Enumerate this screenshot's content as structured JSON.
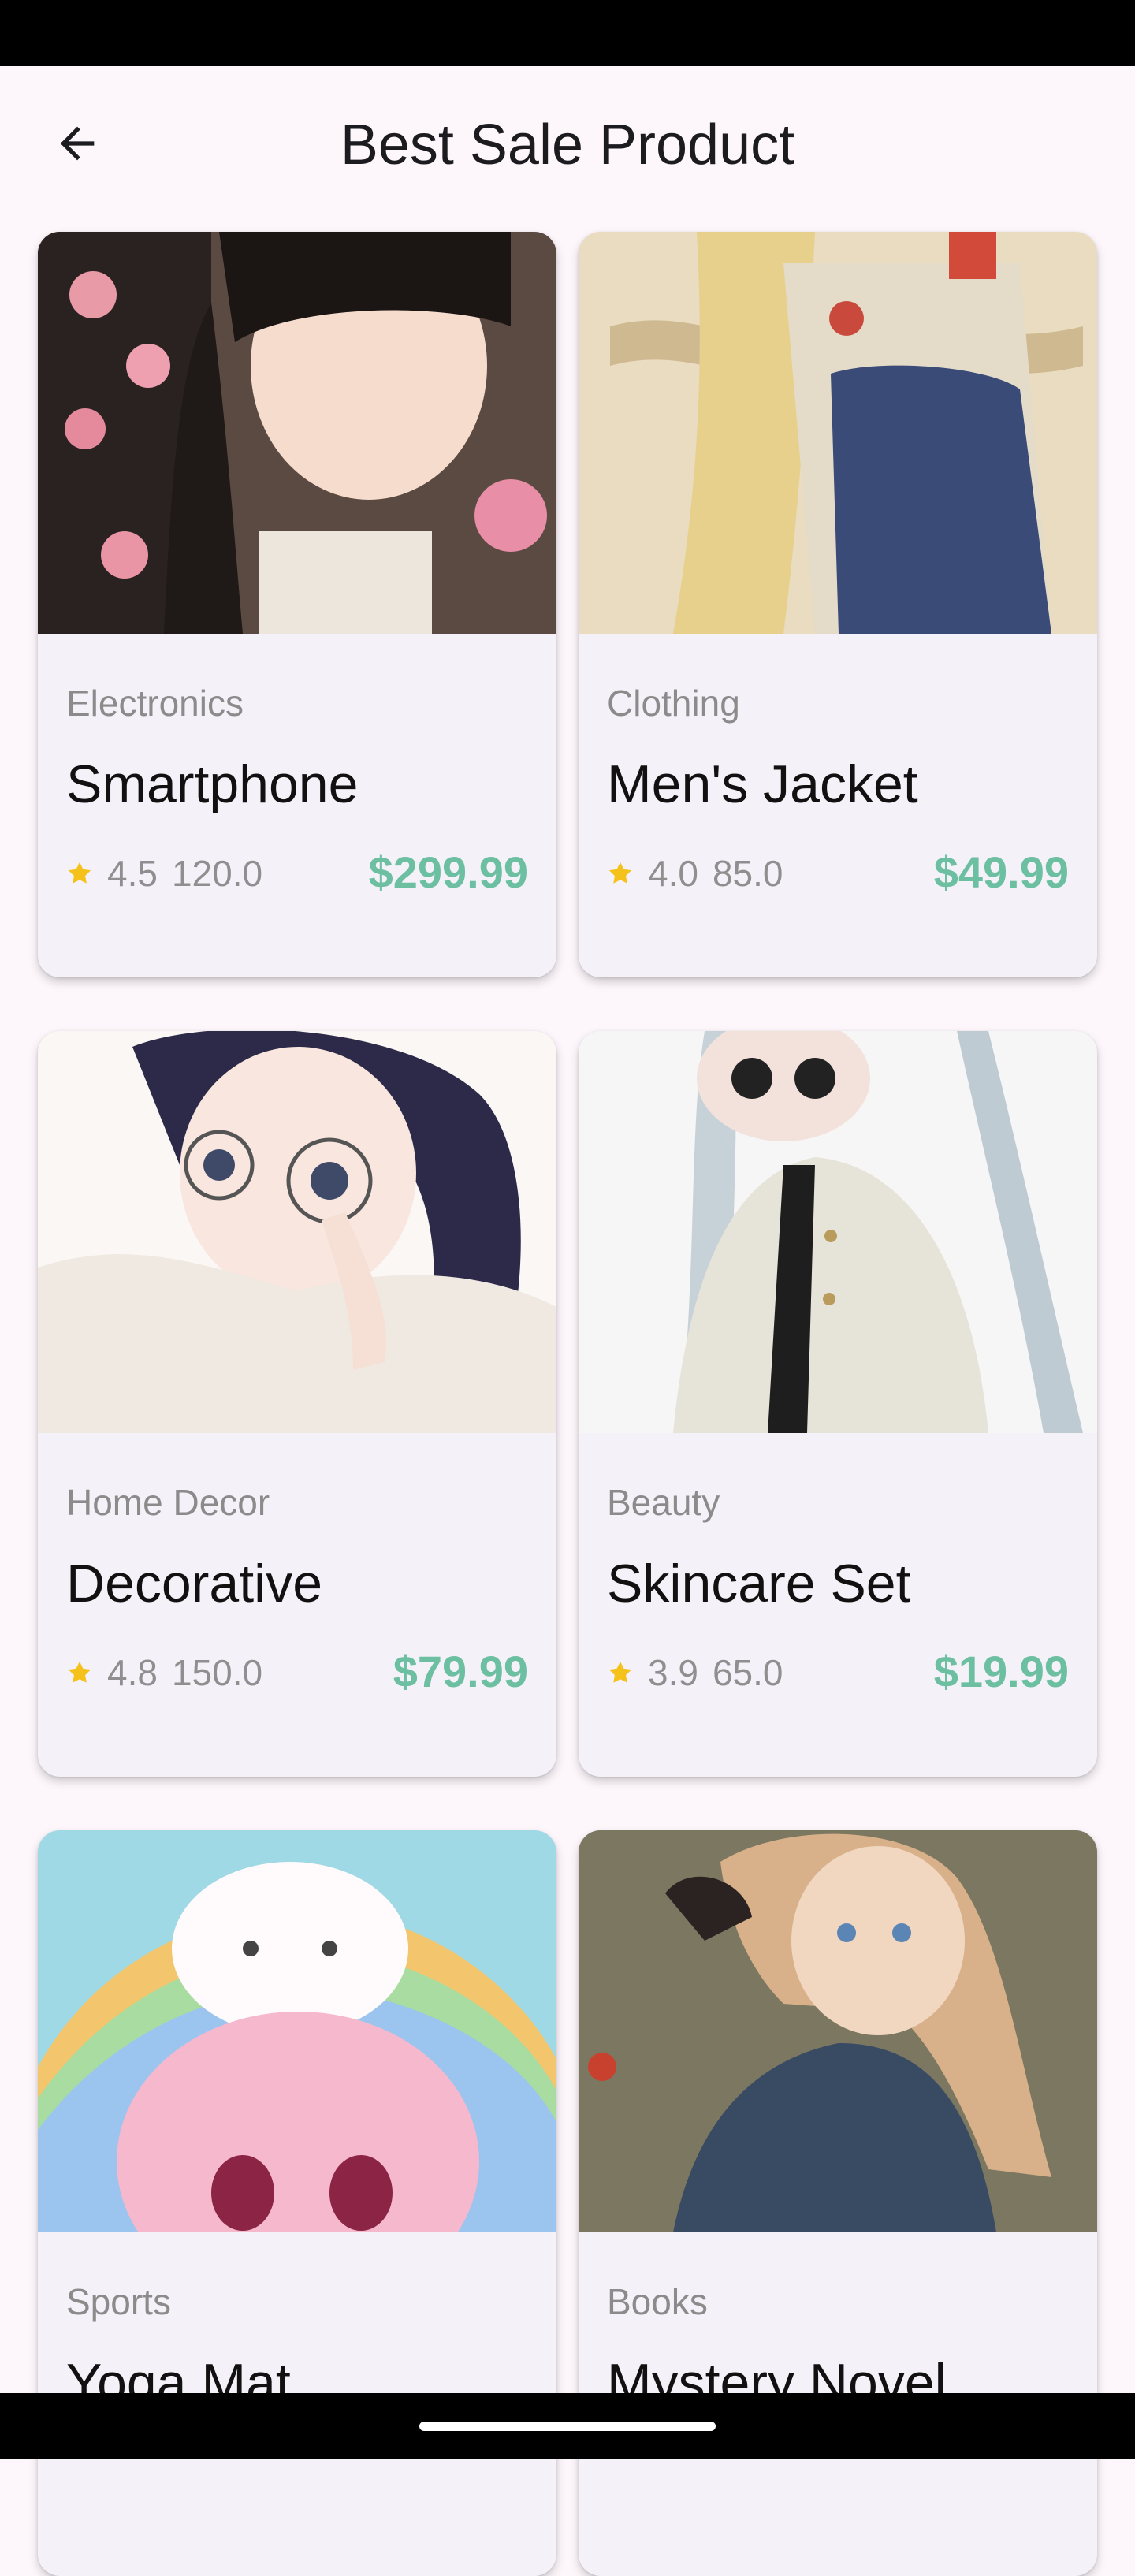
{
  "app_bar": {
    "title": "Best Sale Product",
    "back_icon": "arrow-back-icon"
  },
  "products": [
    {
      "category": "Electronics",
      "name": "Smartphone",
      "rating": "4.5",
      "reviews": "120.0",
      "price": "$299.99"
    },
    {
      "category": "Clothing",
      "name": "Men's Jacket",
      "rating": "4.0",
      "reviews": "85.0",
      "price": "$49.99"
    },
    {
      "category": "Home Decor",
      "name": "Decorative",
      "rating": "4.8",
      "reviews": "150.0",
      "price": "$79.99"
    },
    {
      "category": "Beauty",
      "name": "Skincare Set",
      "rating": "3.9",
      "reviews": "65.0",
      "price": "$19.99"
    },
    {
      "category": "Sports",
      "name": "Yoga Mat",
      "rating": "",
      "reviews": "",
      "price": ""
    },
    {
      "category": "Books",
      "name": "Mystery Novel",
      "rating": "",
      "reviews": "",
      "price": ""
    }
  ],
  "colors": {
    "background": "#fdf7fc",
    "card": "#f5f1f8",
    "price": "#6dbfa2",
    "star": "#f4c21b",
    "muted_text": "#8f8f8f"
  }
}
